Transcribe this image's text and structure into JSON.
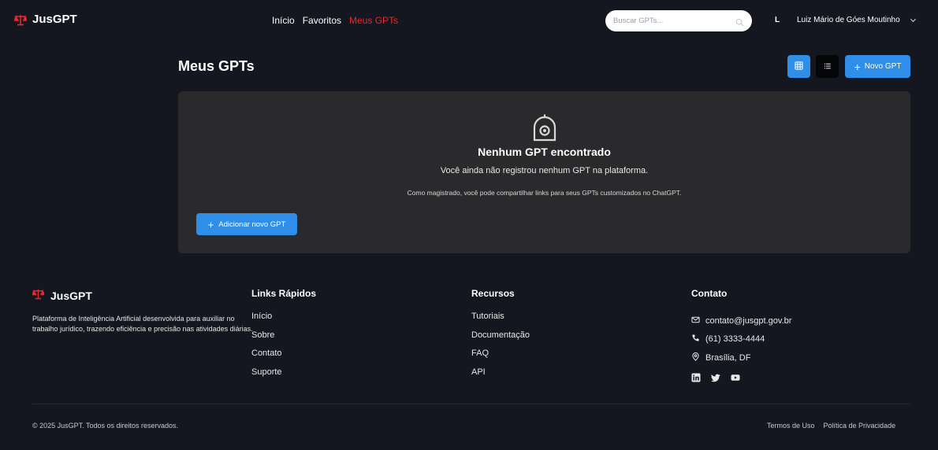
{
  "brand": {
    "name": "JusGPT",
    "color": "#e5282a"
  },
  "nav": {
    "items": [
      "Início",
      "Favoritos",
      "Meus GPTs"
    ],
    "active": "Meus GPTs"
  },
  "search": {
    "placeholder": "Buscar GPTs..."
  },
  "user": {
    "initial": "L",
    "name": "Luiz Mário de Góes Moutinho"
  },
  "page": {
    "title": "Meus GPTs",
    "new_button": "Novo GPT",
    "view_modes": [
      "grid",
      "list"
    ],
    "active_view": "grid"
  },
  "empty_state": {
    "title": "Nenhum GPT encontrado",
    "description": "Você ainda não registrou nenhum GPT na plataforma.",
    "note": "Como magistrado, você pode compartilhar links para seus GPTs customizados no ChatGPT.",
    "add_button": "Adicionar novo GPT"
  },
  "footer": {
    "brand": "JusGPT",
    "description": "Plataforma de Inteligência Artificial desenvolvida para auxiliar no trabalho jurídico, trazendo eficiência e precisão nas atividades diárias.",
    "quick_links": {
      "title": "Links Rápidos",
      "items": [
        "Início",
        "Sobre",
        "Contato",
        "Suporte"
      ]
    },
    "resources": {
      "title": "Recursos",
      "items": [
        "Tutoriais",
        "Documentação",
        "FAQ",
        "API"
      ]
    },
    "contact": {
      "title": "Contato",
      "email": "contato@jusgpt.gov.br",
      "phone": "(61) 3333-4444",
      "location": "Brasília, DF",
      "social": [
        "linkedin-icon",
        "twitter-icon",
        "youtube-icon"
      ]
    },
    "copyright": "© 2025 JusGPT. Todos os direitos reservados.",
    "legal": [
      "Termos de Uso",
      "Política de Privacidade"
    ]
  },
  "colors": {
    "accent": "#2f8fe8",
    "background": "#14171f",
    "card": "#2a2a2c",
    "active_nav": "#e5282a"
  }
}
